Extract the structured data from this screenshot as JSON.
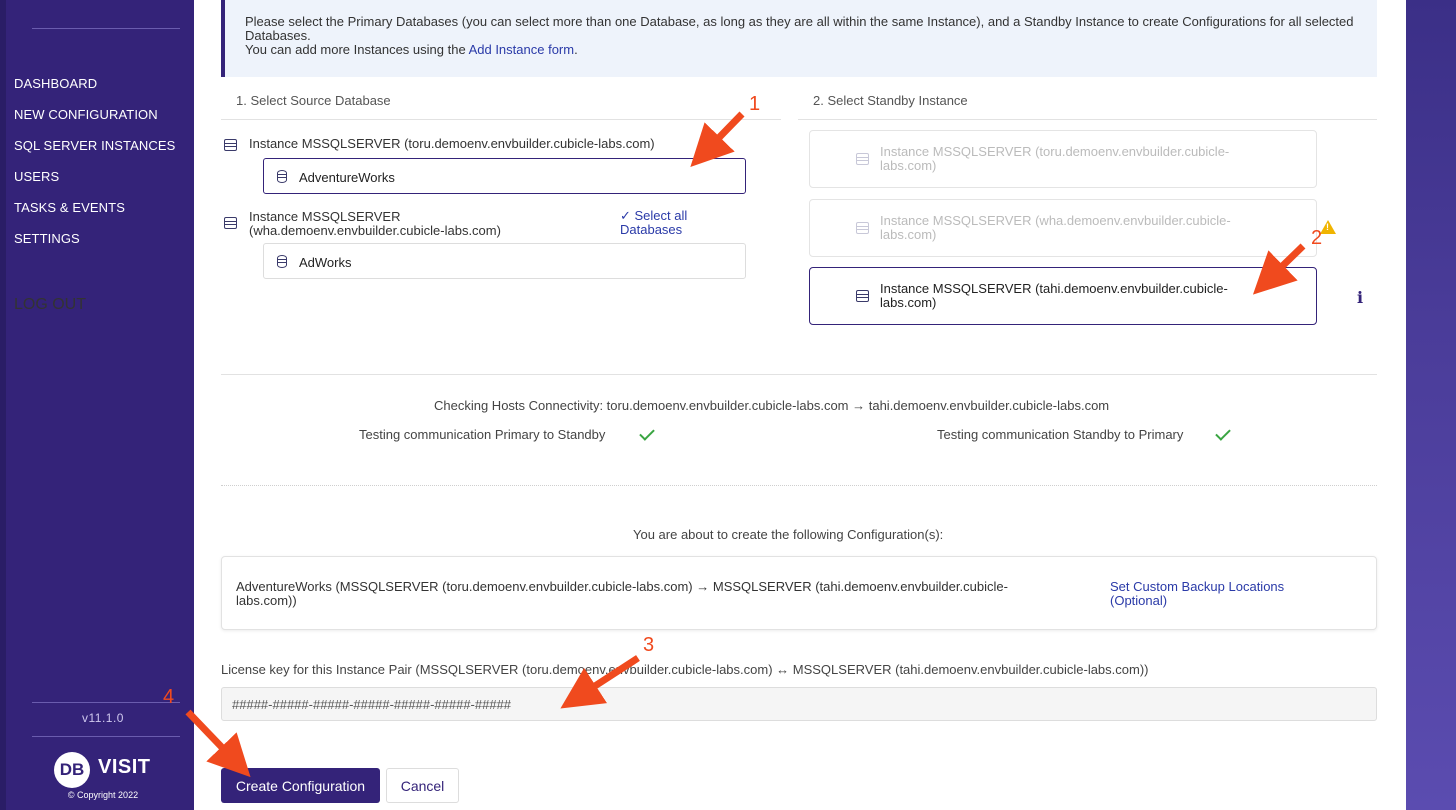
{
  "sidebar": {
    "nav": [
      "DASHBOARD",
      "NEW CONFIGURATION",
      "SQL SERVER INSTANCES",
      "USERS",
      "TASKS & EVENTS",
      "SETTINGS"
    ],
    "logout": "LOG OUT",
    "version": "v11.1.0",
    "logo_initials": "DB",
    "logo_word": "VISIT",
    "copyright": "© Copyright 2022"
  },
  "info": {
    "line1": "Please select the Primary Databases (you can select more than one Database, as long as they are all within the same Instance), and a Standby Instance to create Configurations for all selected Databases.",
    "line2_prefix": "You can add more Instances using the ",
    "line2_link": "Add Instance form",
    "line2_suffix": "."
  },
  "source": {
    "step_label": "1. Select Source Database",
    "instances": [
      {
        "label": "Instance MSSQLSERVER (toru.demoenv.envbuilder.cubicle-labs.com)",
        "databases": [
          "AdventureWorks"
        ]
      },
      {
        "label_line1": "Instance MSSQLSERVER",
        "label_line2": "(wha.demoenv.envbuilder.cubicle-labs.com)",
        "databases": [
          "AdWorks"
        ]
      }
    ],
    "select_all_line1": "✓ Select all",
    "select_all_line2": "Databases"
  },
  "standby": {
    "step_label": "2. Select Standby Instance",
    "instances": [
      {
        "line1": "Instance MSSQLSERVER (toru.demoenv.envbuilder.cubicle-",
        "line2": "labs.com)",
        "state": "disabled"
      },
      {
        "line1": "Instance MSSQLSERVER (wha.demoenv.envbuilder.cubicle-",
        "line2": "labs.com)",
        "state": "disabled"
      },
      {
        "line1": "Instance MSSQLSERVER (tahi.demoenv.envbuilder.cubicle-",
        "line2": "labs.com)",
        "state": "selected"
      }
    ],
    "warning_glyph": "!",
    "info_glyph": "i"
  },
  "connectivity": {
    "heading": "Checking Hosts Connectivity: toru.demoenv.envbuilder.cubicle-labs.com → tahi.demoenv.envbuilder.cubicle-labs.com",
    "primary_to_standby": "Testing communication Primary to Standby",
    "standby_to_primary": "Testing communication Standby to Primary"
  },
  "configuration": {
    "heading": "You are about to create the following Configuration(s):",
    "desc_line1": "AdventureWorks (MSSQLSERVER (toru.demoenv.envbuilder.cubicle-labs.com) → MSSQLSERVER (tahi.demoenv.envbuilder.cubicle-",
    "desc_line2": "labs.com))",
    "link_line1": "Set Custom Backup Locations",
    "link_line2": "(Optional)"
  },
  "license": {
    "label": "License key for this Instance Pair (MSSQLSERVER (toru.demoenv.envbuilder.cubicle-labs.com) ↔ MSSQLSERVER (tahi.demoenv.envbuilder.cubicle-labs.com))",
    "value": "#####-#####-#####-#####-#####-#####-#####"
  },
  "buttons": {
    "create": "Create Configuration",
    "cancel": "Cancel"
  },
  "annotations": [
    "1",
    "2",
    "3",
    "4"
  ],
  "colors": {
    "brand": "#342379",
    "link": "#2a3aa8",
    "success": "#3aa542",
    "warning": "#f0b400",
    "annotation": "#f04a1e"
  }
}
